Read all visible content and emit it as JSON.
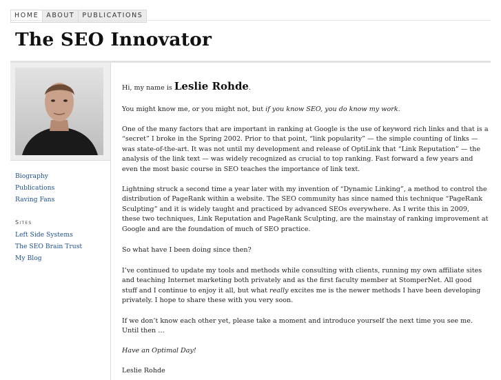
{
  "nav": {
    "tabs": [
      "HOME",
      "ABOUT",
      "PUBLICATIONS"
    ]
  },
  "site": {
    "title": "The SEO Innovator"
  },
  "sidebar": {
    "links": [
      "Biography",
      "Publications",
      "Raving Fans"
    ],
    "sites_heading": "Sites",
    "sites": [
      "Left Side Systems",
      "The SEO Brain Trust",
      "My Blog"
    ]
  },
  "content": {
    "greeting_prefix": "Hi, my name is ",
    "greeting_name": "Leslie Rohde",
    "greeting_suffix": ".",
    "p1_plain": "You might know me, or you might not, but ",
    "p1_italic": "if you know SEO, you do know my work.",
    "p2": "One of the many factors that are important in ranking at Google is the use of keyword rich links and that is a “secret” I broke in the Spring 2002. Prior to that point, “link popularity” — the simple counting of links — was state-of-the-art. It was not until my development and release of OptiLink that “Link Reputation” — the analysis of the link text — was widely recognized as crucial to top ranking. Fast forward a few years and even the most basic course in SEO teaches the importance of link text.",
    "p3": "Lightning struck a second time a year later with my invention of “Dynamic Linking”, a method to control the distribution of PageRank within a website. The SEO community has since named this technique “PageRank Sculpting” and it is widely taught and practiced by advanced SEOs everywhere. As I write this in 2009, these two techniques, Link Reputation and PageRank Sculpting, are the mainstay of ranking improvement at Google and are the foundation of much of SEO practice.",
    "p4": "So what have I been doing since then?",
    "p5_a": "I’ve continued to update my tools and methods while consulting with clients, running my own affiliate sites and teaching Internet marketing both privately and as the first faculty member at StomperNet. All good stuff and I continue to enjoy it all, but what ",
    "p5_italic": "really",
    "p5_b": " excites me is the newer methods I have been developing privately. I hope to share these with you very soon.",
    "p6": "If we don’t know each other yet, please take a moment and introduce yourself the next time you see me. Until then …",
    "p7": "Have an Optimal Day!",
    "p8": "Leslie Rohde"
  }
}
